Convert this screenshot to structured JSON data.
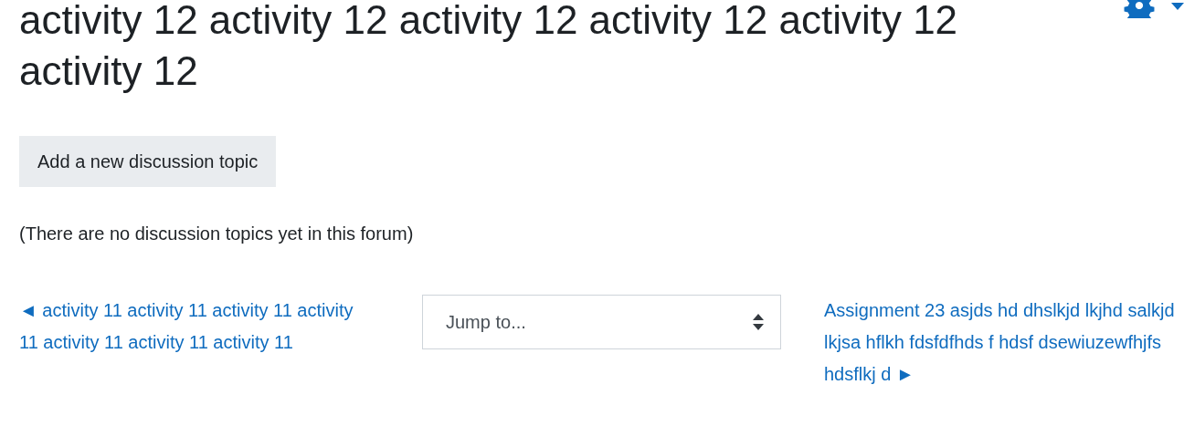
{
  "title": "activity 12 activity 12 activity 12 activity 12 activity 12 activity 12",
  "add_button": "Add a new discussion topic",
  "empty_message": "(There are no discussion topics yet in this forum)",
  "navigation": {
    "previous": "◄ activity 11 activity 11 activity 11 activity 11 activity 11 activity 11 activity 11",
    "jump_select": {
      "value": "Jump to..."
    },
    "next": "Assignment 23 asjds hd dhslkjd lkjhd salkjd lkjsa hflkh fdsfdfhds f hdsf dsewiuzewfhjfs hdsflkj d ►"
  }
}
